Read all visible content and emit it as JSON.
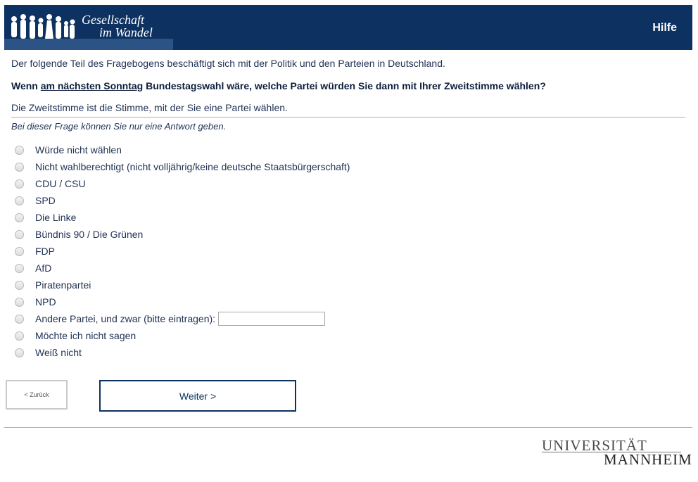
{
  "header": {
    "logo_line1": "Gesellschaft",
    "logo_line2": "im Wandel",
    "help_label": "Hilfe",
    "bg_color": "#0d3160"
  },
  "survey": {
    "intro": "Der folgende Teil des Fragebogens beschäftigt sich mit der Politik und den Parteien in Deutschland.",
    "question_pre": "Wenn ",
    "question_emph": "am nächsten Sonntag",
    "question_post": " Bundestagswahl wäre, welche Partei würden Sie dann mit Ihrer Zweitstimme wählen?",
    "note": "Die Zweitstimme ist die Stimme, mit der Sie eine Partei wählen.",
    "instruction": "Bei dieser Frage können Sie nur eine Antwort geben.",
    "options": [
      "Würde nicht wählen",
      "Nicht wahlberechtigt (nicht volljährig/keine deutsche Staatsbürgerschaft)",
      "CDU / CSU",
      "SPD",
      "Die Linke",
      "Bündnis 90 / Die Grünen",
      "FDP",
      "AfD",
      "Piratenpartei",
      "NPD",
      "Andere Partei, und zwar (bitte eintragen):",
      "Möchte ich nicht sagen",
      "Weiß nicht"
    ],
    "other_value": ""
  },
  "nav": {
    "back_label": "< Zurück",
    "next_label": "Weiter >"
  },
  "footer": {
    "uni_line1": "UNIVERSITÄT",
    "uni_line2": "MANNHEIM"
  }
}
